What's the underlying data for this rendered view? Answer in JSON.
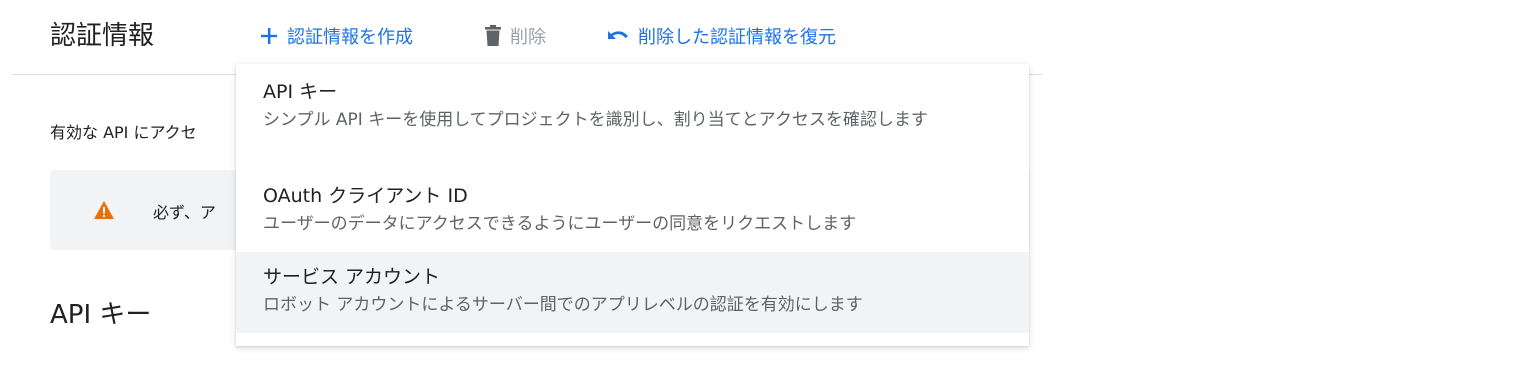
{
  "header": {
    "title": "認証情報",
    "create_label": "認証情報を作成",
    "delete_label": "削除",
    "restore_label": "削除した認証情報を復元"
  },
  "main": {
    "description_visible": "有効な API にアクセ",
    "warning_visible": "必ず、ア",
    "section_title": "API キー"
  },
  "menu": {
    "items": [
      {
        "title": "API キー",
        "description": "シンプル API キーを使用してプロジェクトを識別し、割り当てとアクセスを確認します"
      },
      {
        "title": "OAuth クライアント ID",
        "description": "ユーザーのデータにアクセスできるようにユーザーの同意をリクエストします"
      },
      {
        "title": "サービス アカウント",
        "description": "ロボット アカウントによるサーバー間でのアプリレベルの認証を有効にします"
      }
    ]
  },
  "colors": {
    "accent": "#1a73e8",
    "disabled": "#9aa0a6",
    "warning": "#e8710a",
    "hover_bg": "#f1f3f4"
  },
  "icons": {
    "create": "plus-icon",
    "delete": "trash-icon",
    "restore": "undo-icon",
    "warning": "warning-icon"
  }
}
